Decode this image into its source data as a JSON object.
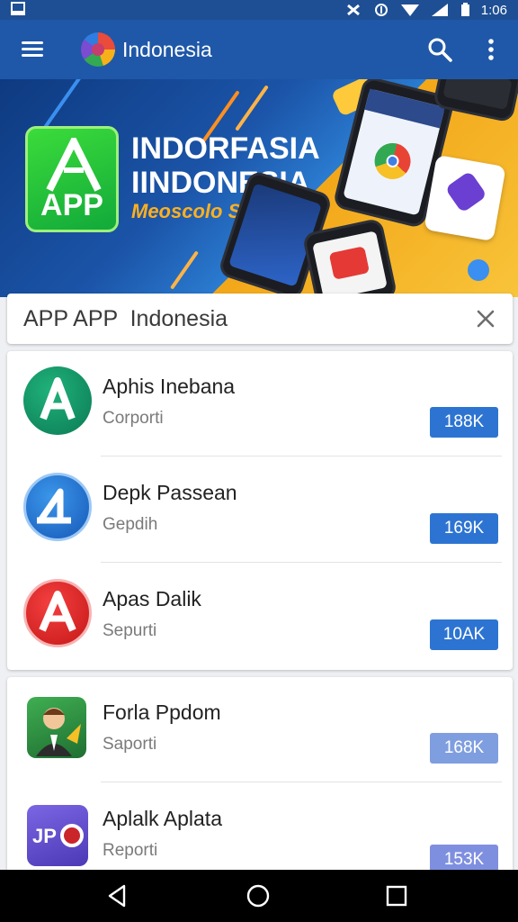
{
  "status_bar": {
    "time": "1:06"
  },
  "app_bar": {
    "title": "Indonesia"
  },
  "banner": {
    "badge_text": "APP",
    "title_line1": "INDORFASIA",
    "title_line2": "IINDONESIA",
    "subtitle": "Meoscolo Stadl ienl"
  },
  "search": {
    "value": "APP APP  Indonesia"
  },
  "apps": [
    {
      "name": "Aphis Inebana",
      "sub": "Corporti",
      "badge": "188K",
      "badge_color": "#2d74d2",
      "icon": "A",
      "icon_colors": [
        "#16a36b",
        "#0b7a55"
      ]
    },
    {
      "name": "Depk Passean",
      "sub": "Gepdih",
      "badge": "169K",
      "badge_color": "#2d74d2",
      "icon": "Δ",
      "icon_colors": [
        "#2a86df",
        "#1658b8"
      ]
    },
    {
      "name": "Apas Dalik",
      "sub": "Sepurti",
      "badge": "10AK",
      "badge_color": "#2d74d2",
      "icon": "A",
      "icon_colors": [
        "#ef2f2f",
        "#c51717"
      ]
    },
    {
      "name": "Forla Ppdom",
      "sub": "Saporti",
      "badge": "168K",
      "badge_color": "#7f9ee0",
      "icon": "person",
      "icon_colors": [
        "#3a9e4b",
        "#1f6f31"
      ]
    },
    {
      "name": "Aplalk Aplata",
      "sub": "Reporti",
      "badge": "153K",
      "badge_color": "#7f8fe0",
      "icon": "JPO",
      "icon_colors": [
        "#6f5ad9",
        "#4b39b6"
      ]
    }
  ]
}
